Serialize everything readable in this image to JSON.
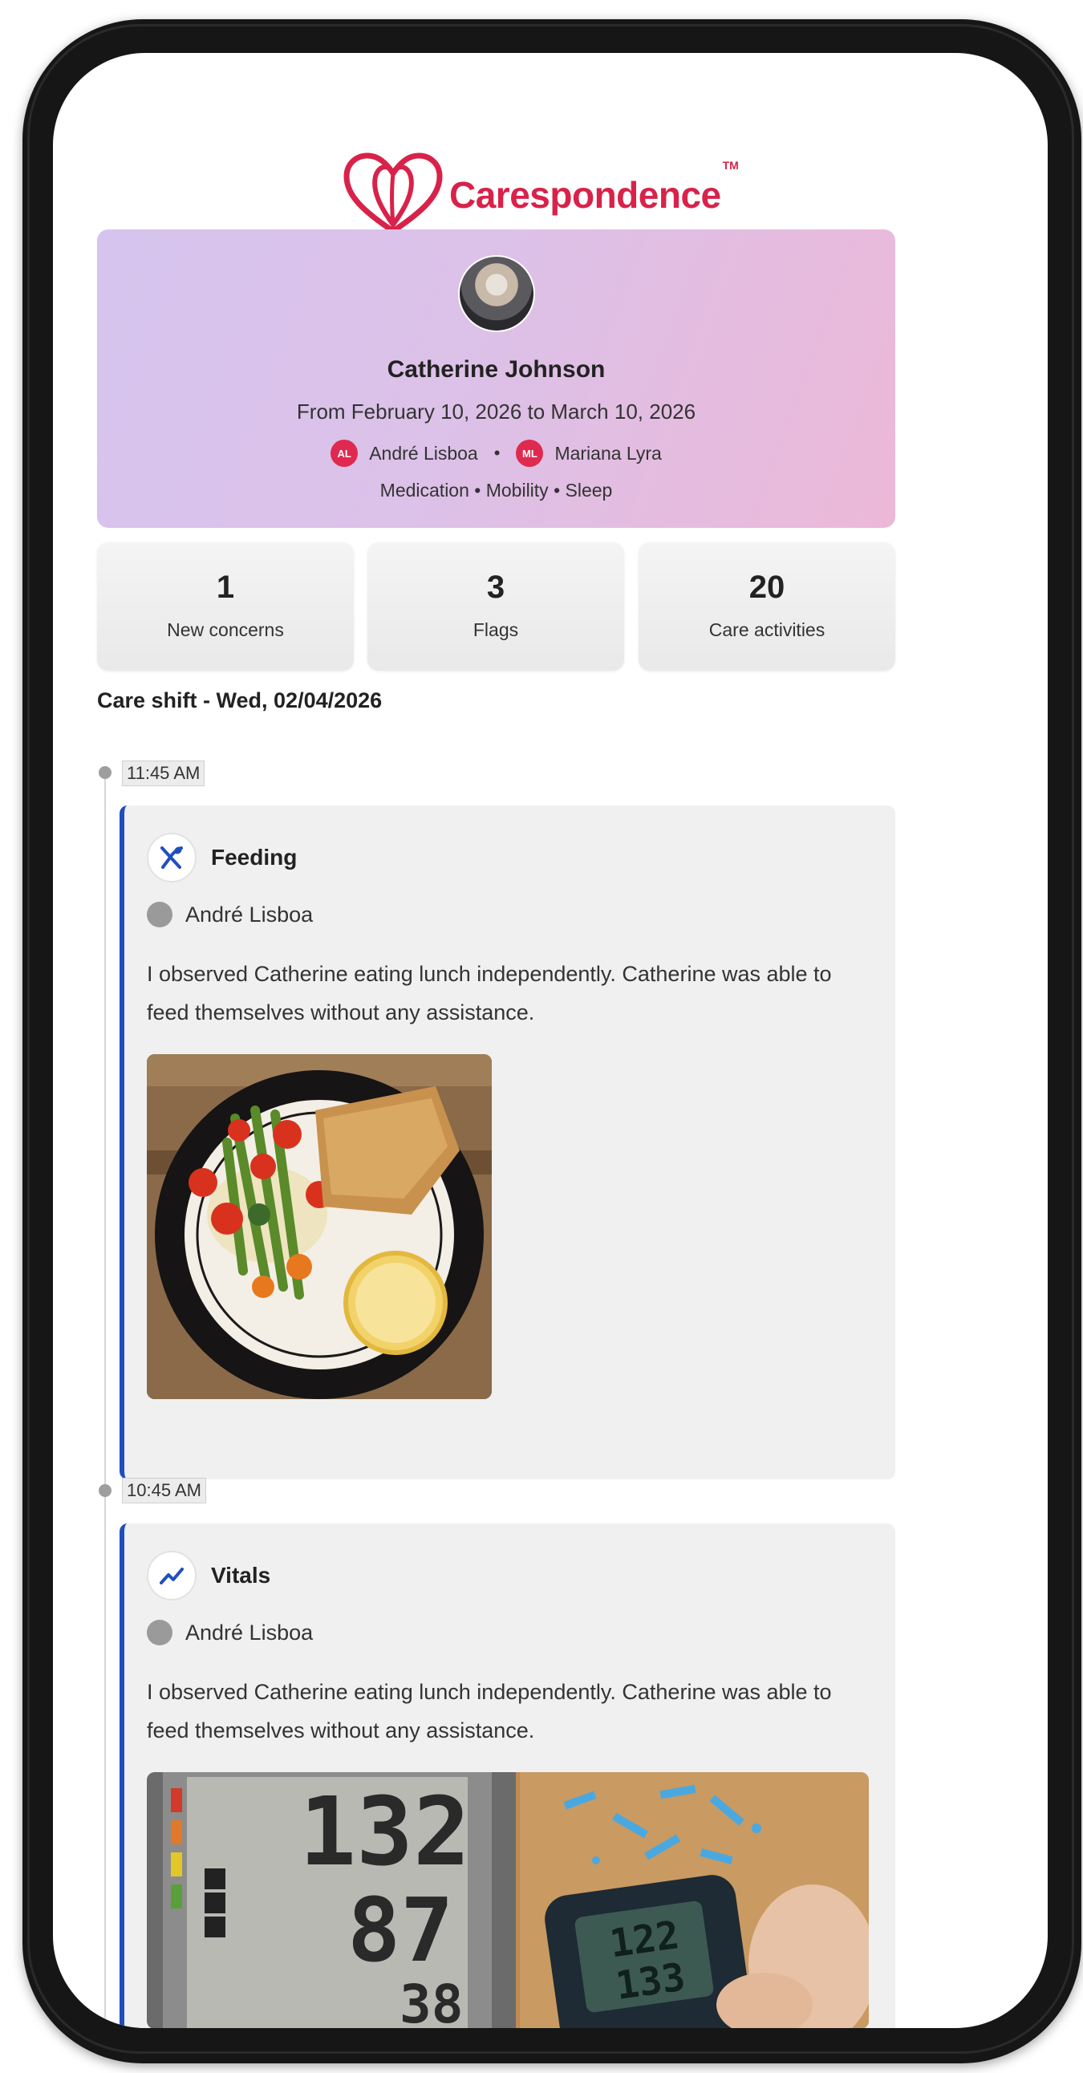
{
  "brand": {
    "name": "Carespondence",
    "tm": "TM",
    "color": "#d8224a"
  },
  "profile": {
    "name": "Catherine Johnson",
    "date_range": "From February 10, 2026 to March 10, 2026",
    "caregivers": [
      {
        "initials": "AL",
        "name": "André Lisboa"
      },
      {
        "initials": "ML",
        "name": "Mariana Lyra"
      }
    ],
    "separator": "•",
    "tags": "Medication • Mobility • Sleep"
  },
  "stats": [
    {
      "value": "1",
      "label": "New concerns"
    },
    {
      "value": "3",
      "label": "Flags"
    },
    {
      "value": "20",
      "label": "Care activities"
    }
  ],
  "shift": {
    "title": "Care shift - Wed, 02/04/2026"
  },
  "entries": [
    {
      "time": "11:45 AM",
      "type": "Feeding",
      "icon": "fork-knife-icon",
      "author": "André Lisboa",
      "text": "I observed Catherine eating lunch independently.  Catherine was able to feed themselves without any assistance."
    },
    {
      "time": "10:45 AM",
      "type": "Vitals",
      "icon": "trend-line-icon",
      "author": "André Lisboa",
      "text": "I observed Catherine eating lunch independently.  Catherine was able to feed themselves without any assistance.",
      "readings": {
        "bp_top": "132",
        "bp_bottom": "87",
        "pulse": "38",
        "glucose_top": "122",
        "glucose_bottom": "133"
      }
    }
  ],
  "colors": {
    "accent": "#1f4fbf",
    "avatar_badge": "#e0294f"
  }
}
